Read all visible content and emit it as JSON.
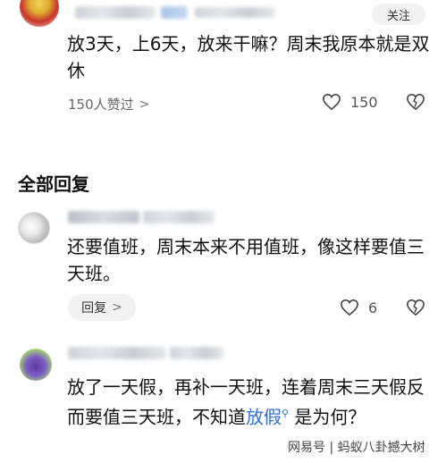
{
  "post": {
    "follow_label": "关注",
    "text": "放3天，上6天，放来干嘛？周末我原本就是双休",
    "likers_text": "150人赞过",
    "chevron": ">",
    "like_count": "150"
  },
  "section": {
    "title": "全部回复"
  },
  "replies": [
    {
      "text": "还要值班，周末本来不用值班，像这样要值三天班。",
      "reply_label": "回复",
      "chevron": ">",
      "like_count": "6"
    },
    {
      "text_before": "放了一天假，再补一天班，连着周末三天假反而要值三天班，不知道",
      "link_word": "放假",
      "text_after": "是为何？"
    }
  ],
  "watermark": {
    "text": "网易号 | 蚂蚁八卦撼大树"
  },
  "colors": {
    "link": "#2f6fd6",
    "button_bg": "#f2f2f2"
  }
}
